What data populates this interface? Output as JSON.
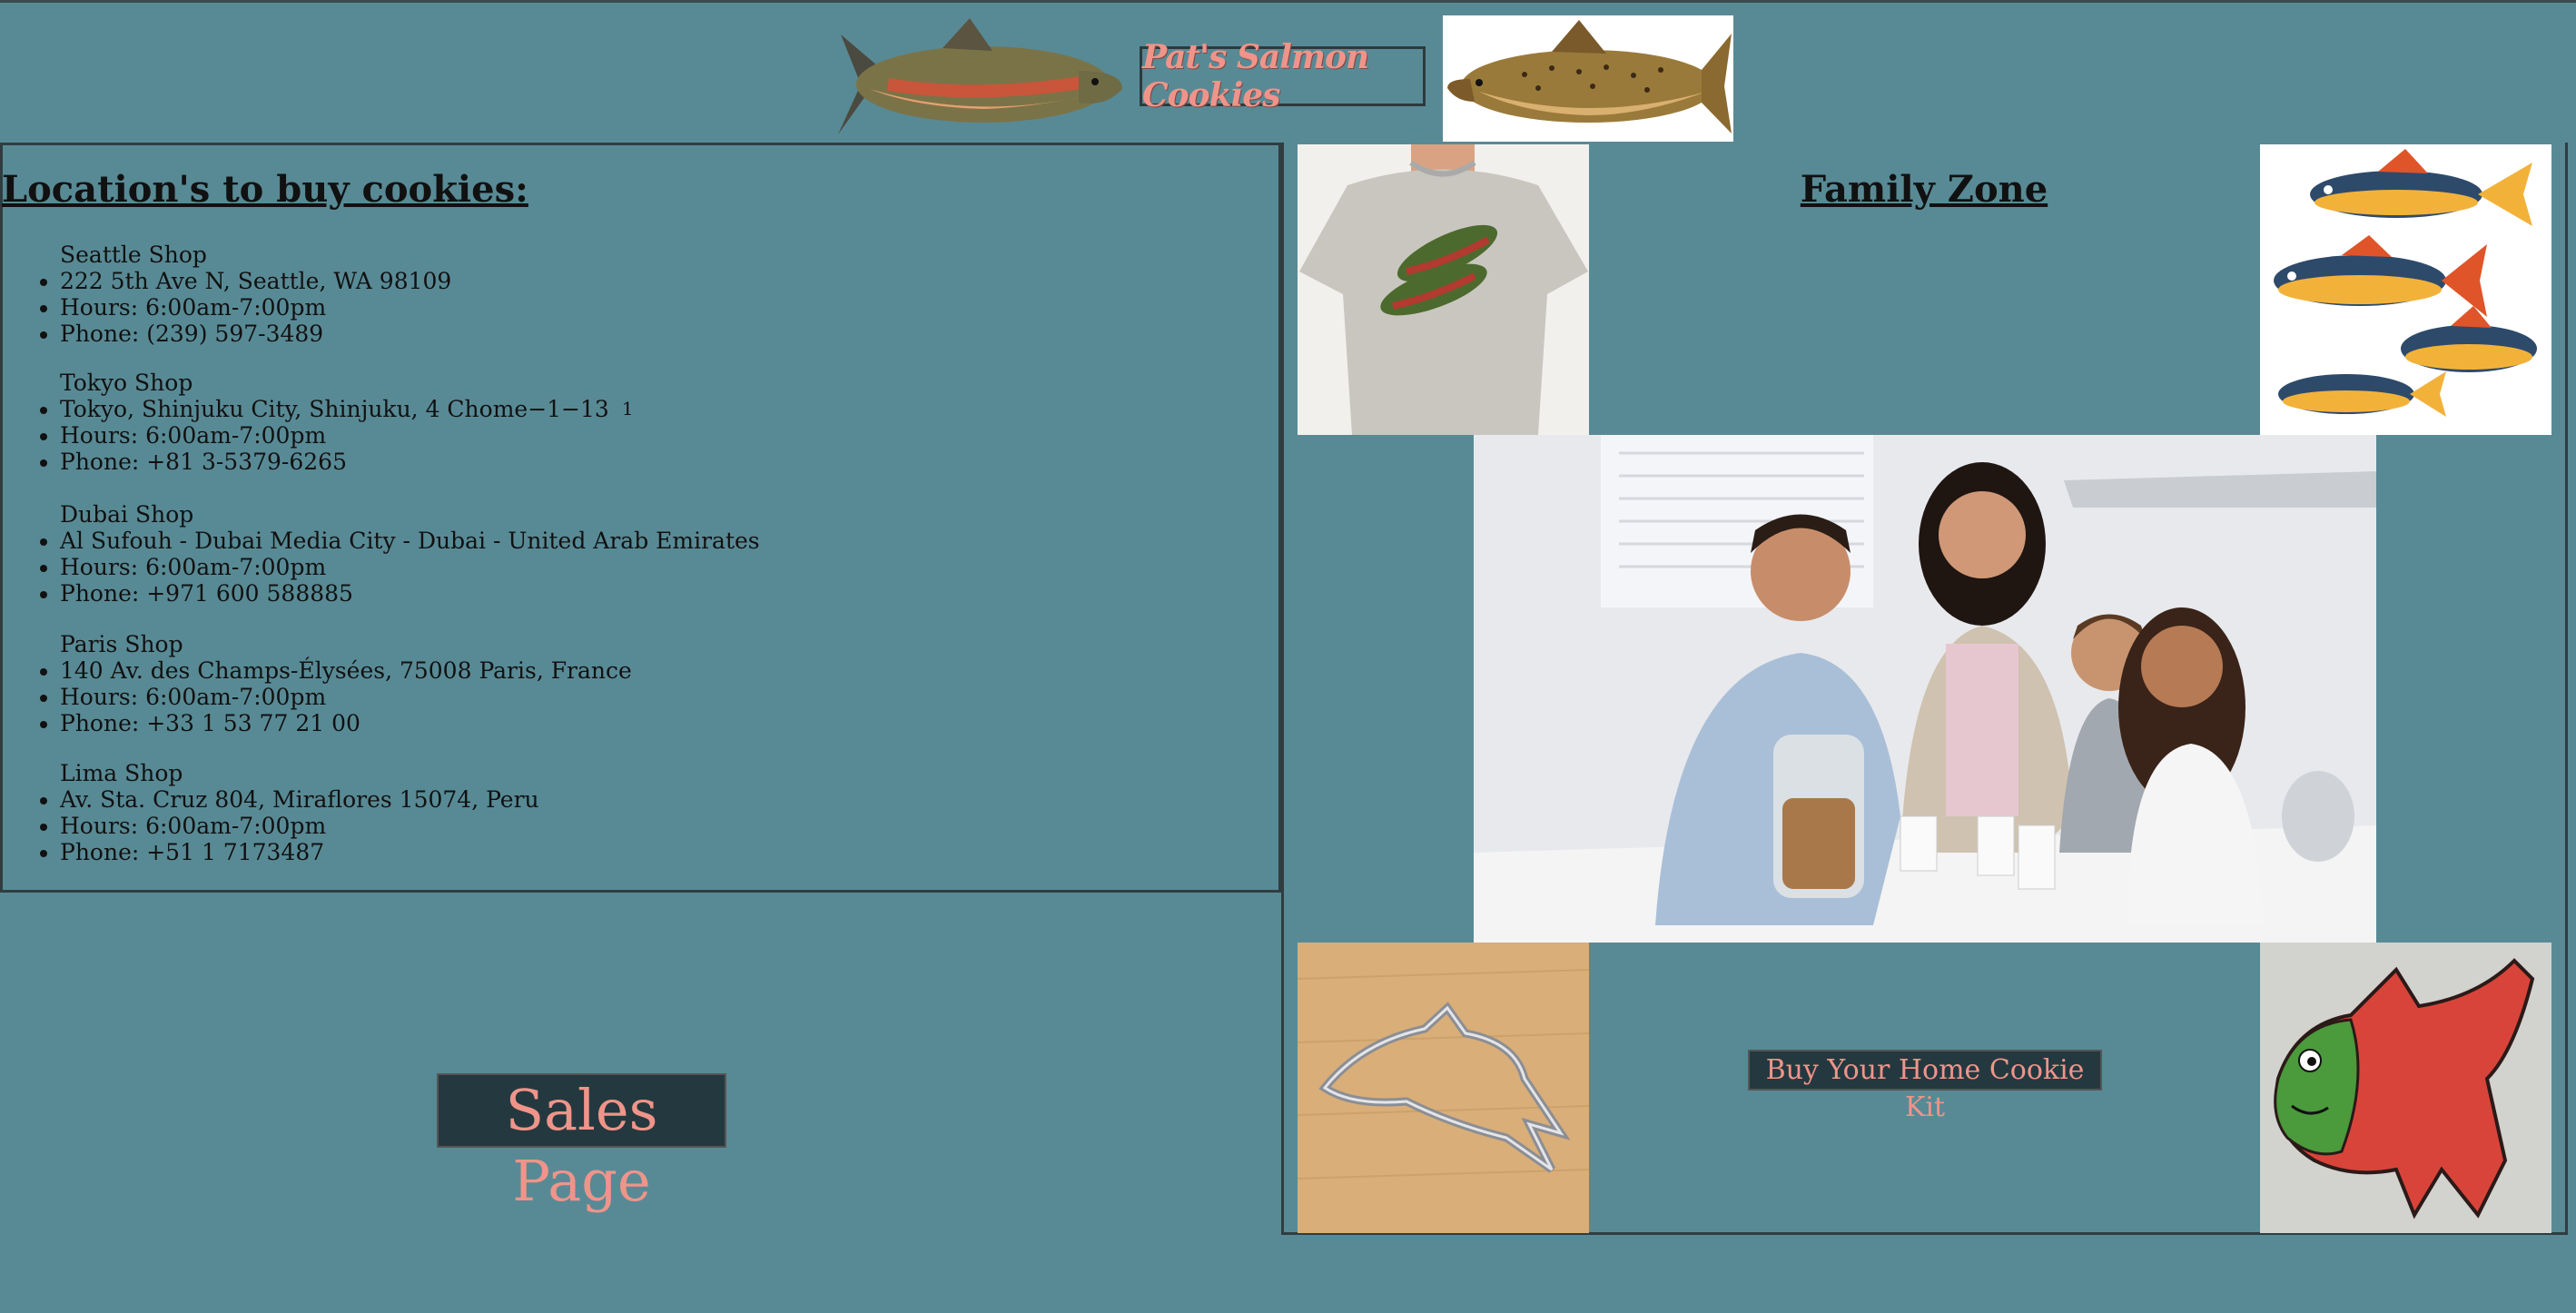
{
  "header": {
    "title": "Pat's Salmon Cookies",
    "accent_color": "#f0948a",
    "background_color": "#588a95"
  },
  "locations": {
    "heading": "Location's to buy cookies:",
    "shops": [
      {
        "name": "Seattle Shop",
        "address": "222 5th Ave N, Seattle, WA 98109",
        "hours": "Hours: 6:00am-7:00pm",
        "phone": "Phone: (239) 597-3489"
      },
      {
        "name": "Tokyo Shop",
        "address": "Tokyo, Shinjuku City, Shinjuku, 4 Chome−1−13",
        "mark": "1",
        "hours": "Hours: 6:00am-7:00pm",
        "phone": "Phone: +81 3-5379-6265"
      },
      {
        "name": "Dubai Shop",
        "address": "Al Sufouh - Dubai Media City - Dubai - United Arab Emirates",
        "hours": "Hours: 6:00am-7:00pm",
        "phone": "Phone: +971 600 588885"
      },
      {
        "name": "Paris Shop",
        "address": "140 Av. des Champs-Élysées, 75008 Paris, France",
        "hours": "Hours: 6:00am-7:00pm",
        "phone": "Phone: +33 1 53 77 21 00"
      },
      {
        "name": "Lima Shop",
        "address": "Av. Sta. Cruz 804, Miraflores 15074, Peru",
        "hours": "Hours: 6:00am-7:00pm",
        "phone": "Phone: +51 1 7173487"
      }
    ]
  },
  "sales": {
    "label": "Sales Page"
  },
  "family": {
    "heading": "Family Zone",
    "kit_button": "Buy Your Home Cookie Kit"
  },
  "images": {
    "fish_left": "salmon-illustration",
    "fish_right": "spotted-salmon-illustration",
    "shirt": "salmon-tshirt",
    "fish_group": "cartoon-fish-group",
    "family": "family-with-cookie-jar",
    "cutter": "fish-cookie-cutter",
    "cookie": "salmon-decorated-cookie"
  }
}
